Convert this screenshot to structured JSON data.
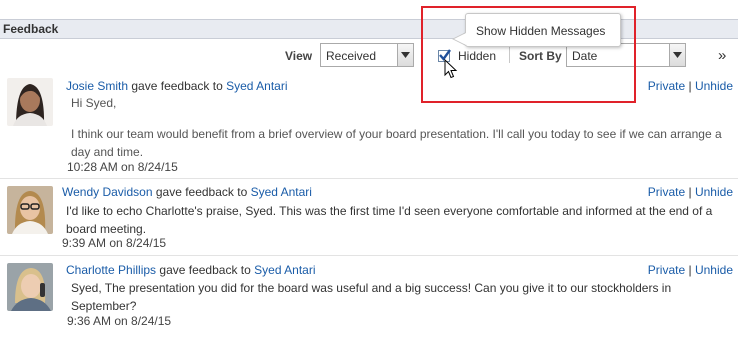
{
  "header": {
    "title": "Feedback"
  },
  "toolbar": {
    "view_label": "View",
    "view_value": "Received",
    "hidden_label": "Hidden",
    "hidden_checked": true,
    "sort_label": "Sort By",
    "sort_value": "Date",
    "more_label": "»"
  },
  "tooltip": {
    "text": "Show Hidden Messages"
  },
  "items": [
    {
      "author": "Josie Smith",
      "verb": "gave feedback to",
      "recipient": "Syed Antari",
      "greeting": "Hi Syed,",
      "message": "I think our team would benefit from a brief overview of your board presentation. I'll call you today to see if we can arrange a day and time.",
      "time": "10:28 AM on 8/24/15",
      "private": "Private",
      "sep": "|",
      "unhide": "Unhide"
    },
    {
      "author": "Wendy Davidson",
      "verb": "gave feedback to",
      "recipient": "Syed Antari",
      "message": "I'd like to echo Charlotte's praise, Syed. This was the first time I'd seen everyone comfortable and informed at the end of a board meeting.",
      "time": "9:39 AM on 8/24/15",
      "private": "Private",
      "sep": "|",
      "unhide": "Unhide"
    },
    {
      "author": "Charlotte Phillips",
      "verb": "gave feedback to",
      "recipient": "Syed Antari",
      "message": "Syed, The presentation you did for the board was useful and a big success! Can you give it to our stockholders in September?",
      "time": "9:36 AM on 8/24/15",
      "private": "Private",
      "sep": "|",
      "unhide": "Unhide"
    }
  ],
  "colors": {
    "link": "#1a5ca8",
    "highlight": "#e0222a",
    "header_bg": "#e8ebf1"
  }
}
